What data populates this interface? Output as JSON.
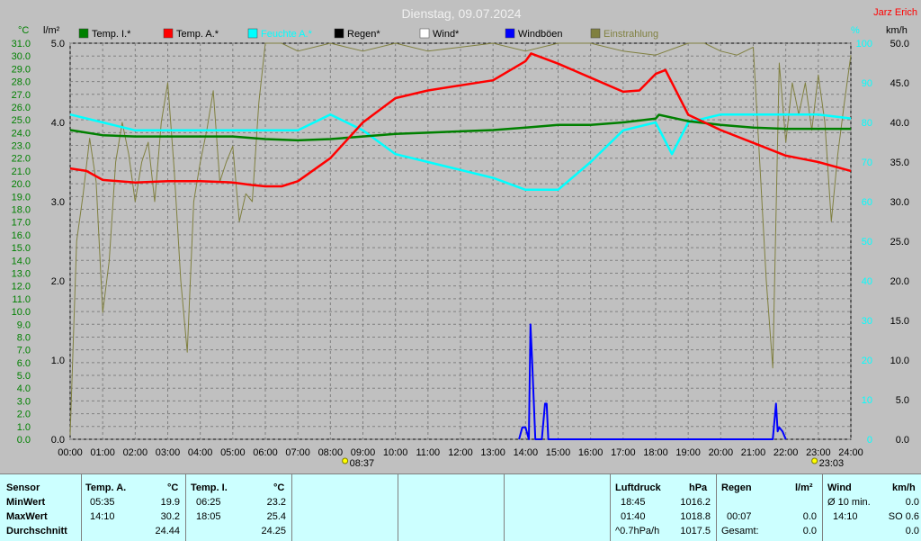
{
  "header": {
    "title": "Dienstag, 09.07.2024",
    "author": "Jarz Erich"
  },
  "colors": {
    "background": "#c0c0c0",
    "plot_bg": "#c0c0c0",
    "grid": "#808080",
    "temp_indoor": "#008000",
    "temp_outdoor": "#ff0000",
    "humidity_outdoor": "#00ffff",
    "rain": "#000000",
    "wind": "#ffffff",
    "gusts": "#0000ff",
    "solar": "#808040",
    "axis_temp_text": "#008000",
    "axis_rain_text": "#000000",
    "axis_hum_text": "#00ffff",
    "axis_wind_text": "#000000",
    "table_bg": "#ccffff"
  },
  "legend": [
    {
      "label": "Temp. I.*",
      "color": "#008000"
    },
    {
      "label": "Temp. A.*",
      "color": "#ff0000"
    },
    {
      "label": "Feuchte A.*",
      "color": "#00ffff"
    },
    {
      "label": "Regen*",
      "color": "#000000"
    },
    {
      "label": "Wind*",
      "color": "#ffffff"
    },
    {
      "label": "Windböen",
      "color": "#0000ff"
    },
    {
      "label": "Einstrahlung",
      "color": "#808040"
    }
  ],
  "axes": {
    "temp_unit": "°C",
    "rain_unit": "l/m²",
    "hum_unit": "%",
    "wind_unit": "km/h",
    "temp_ticks": [
      "0.0",
      "1.0",
      "2.0",
      "3.0",
      "4.0",
      "5.0",
      "6.0",
      "7.0",
      "8.0",
      "9.0",
      "10.0",
      "11.0",
      "12.0",
      "13.0",
      "14.0",
      "15.0",
      "16.0",
      "17.0",
      "18.0",
      "19.0",
      "20.0",
      "21.0",
      "22.0",
      "23.0",
      "24.0",
      "25.0",
      "26.0",
      "27.0",
      "28.0",
      "29.0",
      "30.0",
      "31.0"
    ],
    "rain_ticks": [
      "0.0",
      "1.0",
      "2.0",
      "3.0",
      "4.0",
      "5.0"
    ],
    "hum_ticks": [
      "0",
      "10",
      "20",
      "30",
      "40",
      "50",
      "60",
      "70",
      "80",
      "90",
      "100"
    ],
    "wind_ticks": [
      "0.0",
      "5.0",
      "10.0",
      "15.0",
      "20.0",
      "25.0",
      "30.0",
      "35.0",
      "40.0",
      "45.0",
      "50.0"
    ],
    "time_ticks": [
      "00:00",
      "01:00",
      "02:00",
      "03:00",
      "04:00",
      "05:00",
      "06:00",
      "07:00",
      "08:00",
      "09:00",
      "10:00",
      "11:00",
      "12:00",
      "13:00",
      "14:00",
      "15:00",
      "16:00",
      "17:00",
      "18:00",
      "19:00",
      "20:00",
      "21:00",
      "22:00",
      "23:00",
      "24:00"
    ],
    "sunrise": "08:37",
    "sunset": "23:03"
  },
  "chart_data": {
    "type": "line",
    "title": "Dienstag, 09.07.2024",
    "x_range_hours": [
      0,
      24
    ],
    "temp_range": [
      0,
      31
    ],
    "rain_range": [
      0,
      5
    ],
    "hum_range": [
      0,
      100
    ],
    "wind_range": [
      0,
      50
    ],
    "grid": true,
    "legend_position": "top",
    "series": [
      {
        "name": "Temp. I.*",
        "axis": "temp",
        "x": [
          0,
          1,
          2,
          3,
          4,
          5,
          6,
          7,
          8,
          9,
          10,
          11,
          12,
          13,
          14,
          15,
          16,
          17,
          18,
          18.1,
          19,
          20,
          21,
          22,
          23,
          24
        ],
        "values": [
          24.2,
          23.8,
          23.7,
          23.7,
          23.7,
          23.7,
          23.5,
          23.4,
          23.5,
          23.7,
          23.9,
          24.0,
          24.1,
          24.2,
          24.4,
          24.6,
          24.6,
          24.8,
          25.1,
          25.4,
          24.9,
          24.6,
          24.4,
          24.3,
          24.3,
          24.3
        ]
      },
      {
        "name": "Temp. A.*",
        "axis": "temp",
        "x": [
          0,
          0.5,
          1,
          2,
          3,
          4,
          5,
          5.58,
          6,
          6.5,
          7,
          8,
          9,
          10,
          11,
          12,
          13,
          14,
          14.17,
          15,
          16,
          17,
          17.5,
          18,
          18.3,
          19,
          20,
          21,
          22,
          23,
          24
        ],
        "values": [
          21.2,
          21.0,
          20.3,
          20.1,
          20.2,
          20.2,
          20.1,
          19.9,
          19.8,
          19.8,
          20.2,
          22.0,
          24.8,
          26.7,
          27.3,
          27.7,
          28.1,
          29.6,
          30.2,
          29.4,
          28.3,
          27.2,
          27.3,
          28.6,
          28.9,
          25.4,
          24.2,
          23.2,
          22.2,
          21.7,
          21.0
        ]
      },
      {
        "name": "Feuchte A.*",
        "axis": "hum",
        "x": [
          0,
          1,
          2,
          3,
          4,
          5,
          6,
          7,
          8,
          9,
          10,
          11,
          12,
          13,
          14,
          15,
          16,
          17,
          18,
          18.5,
          19,
          20,
          21,
          22,
          23,
          24
        ],
        "values": [
          82,
          80,
          78,
          78,
          78,
          78,
          78,
          78,
          82,
          78,
          72,
          70,
          68,
          66,
          63,
          63,
          70,
          78,
          80,
          72,
          80,
          82,
          82,
          82,
          82,
          81
        ]
      },
      {
        "name": "Windböen",
        "axis": "wind",
        "x": [
          13.8,
          13.9,
          14.0,
          14.1,
          14.15,
          14.2,
          14.3,
          14.5,
          14.6,
          14.65,
          14.7,
          21.6,
          21.7,
          21.75,
          21.8,
          21.9,
          22.0
        ],
        "values": [
          0,
          1.5,
          1.5,
          0,
          14.5,
          10,
          0,
          0,
          4.5,
          4.5,
          0,
          0,
          4.5,
          1,
          1.5,
          1,
          0
        ]
      },
      {
        "name": "Einstrahlung",
        "axis": "hum",
        "x": [
          0,
          0.2,
          0.4,
          0.6,
          0.8,
          1,
          1.2,
          1.4,
          1.6,
          1.8,
          2,
          2.2,
          2.4,
          2.6,
          2.8,
          3,
          3.2,
          3.4,
          3.6,
          3.8,
          4,
          4.2,
          4.4,
          4.6,
          4.8,
          5,
          5.2,
          5.4,
          5.6,
          5.8,
          6,
          6.5,
          7,
          8,
          9,
          10,
          11,
          12,
          13,
          14,
          15,
          16,
          17,
          18,
          19,
          19.5,
          20,
          20.5,
          21,
          21.2,
          21.4,
          21.6,
          21.8,
          22,
          22.2,
          22.4,
          22.6,
          22.8,
          23,
          23.2,
          23.4,
          23.6,
          23.8,
          24
        ],
        "values": [
          1,
          50,
          62,
          76,
          65,
          32,
          45,
          70,
          80,
          72,
          60,
          70,
          75,
          60,
          80,
          90,
          68,
          40,
          22,
          60,
          70,
          78,
          88,
          65,
          70,
          74,
          55,
          62,
          60,
          85,
          100,
          100,
          98,
          100,
          98,
          100,
          98,
          99,
          100,
          98,
          100,
          100,
          98,
          97,
          100,
          100,
          98,
          97,
          99,
          70,
          40,
          18,
          95,
          75,
          90,
          82,
          90,
          78,
          92,
          80,
          55,
          72,
          85,
          97
        ]
      }
    ]
  },
  "table": {
    "labels": {
      "sensor": "Sensor",
      "min": "MinWert",
      "max": "MaxWert",
      "avg": "Durchschnitt",
      "temp_a": "Temp. A.",
      "temp_i": "Temp. I.",
      "unit_c": "°C",
      "luftdruck": "Luftdruck",
      "hpa": "hPa",
      "regen": "Regen",
      "lm2": "l/m²",
      "wind": "Wind",
      "kmh": "km/h"
    },
    "temp_a": {
      "min_time": "05:35",
      "min_val": "19.9",
      "max_time": "14:10",
      "max_val": "30.2",
      "avg": "24.44"
    },
    "temp_i": {
      "min_time": "06:25",
      "min_val": "23.2",
      "max_time": "18:05",
      "max_val": "25.4",
      "avg": "24.25"
    },
    "pressure": {
      "r1_label": "18:45",
      "r1_val": "1016.2",
      "r2_label": "01:40",
      "r2_val": "1018.8",
      "r3_label": "^0.7hPa/h",
      "r3_val": "1017.5"
    },
    "rain": {
      "r2_label": "00:07",
      "r2_val": "0.0",
      "r3_label": "Gesamt:",
      "r1_val": "0.0",
      "r3_val": "0.0"
    },
    "wind": {
      "r1_label": "Ø 10 min.",
      "r1_val": "0.0",
      "r2_label": "14:10",
      "r2_val": "SO 0.6",
      "r3_label": "",
      "r3_val": "0.0"
    }
  }
}
